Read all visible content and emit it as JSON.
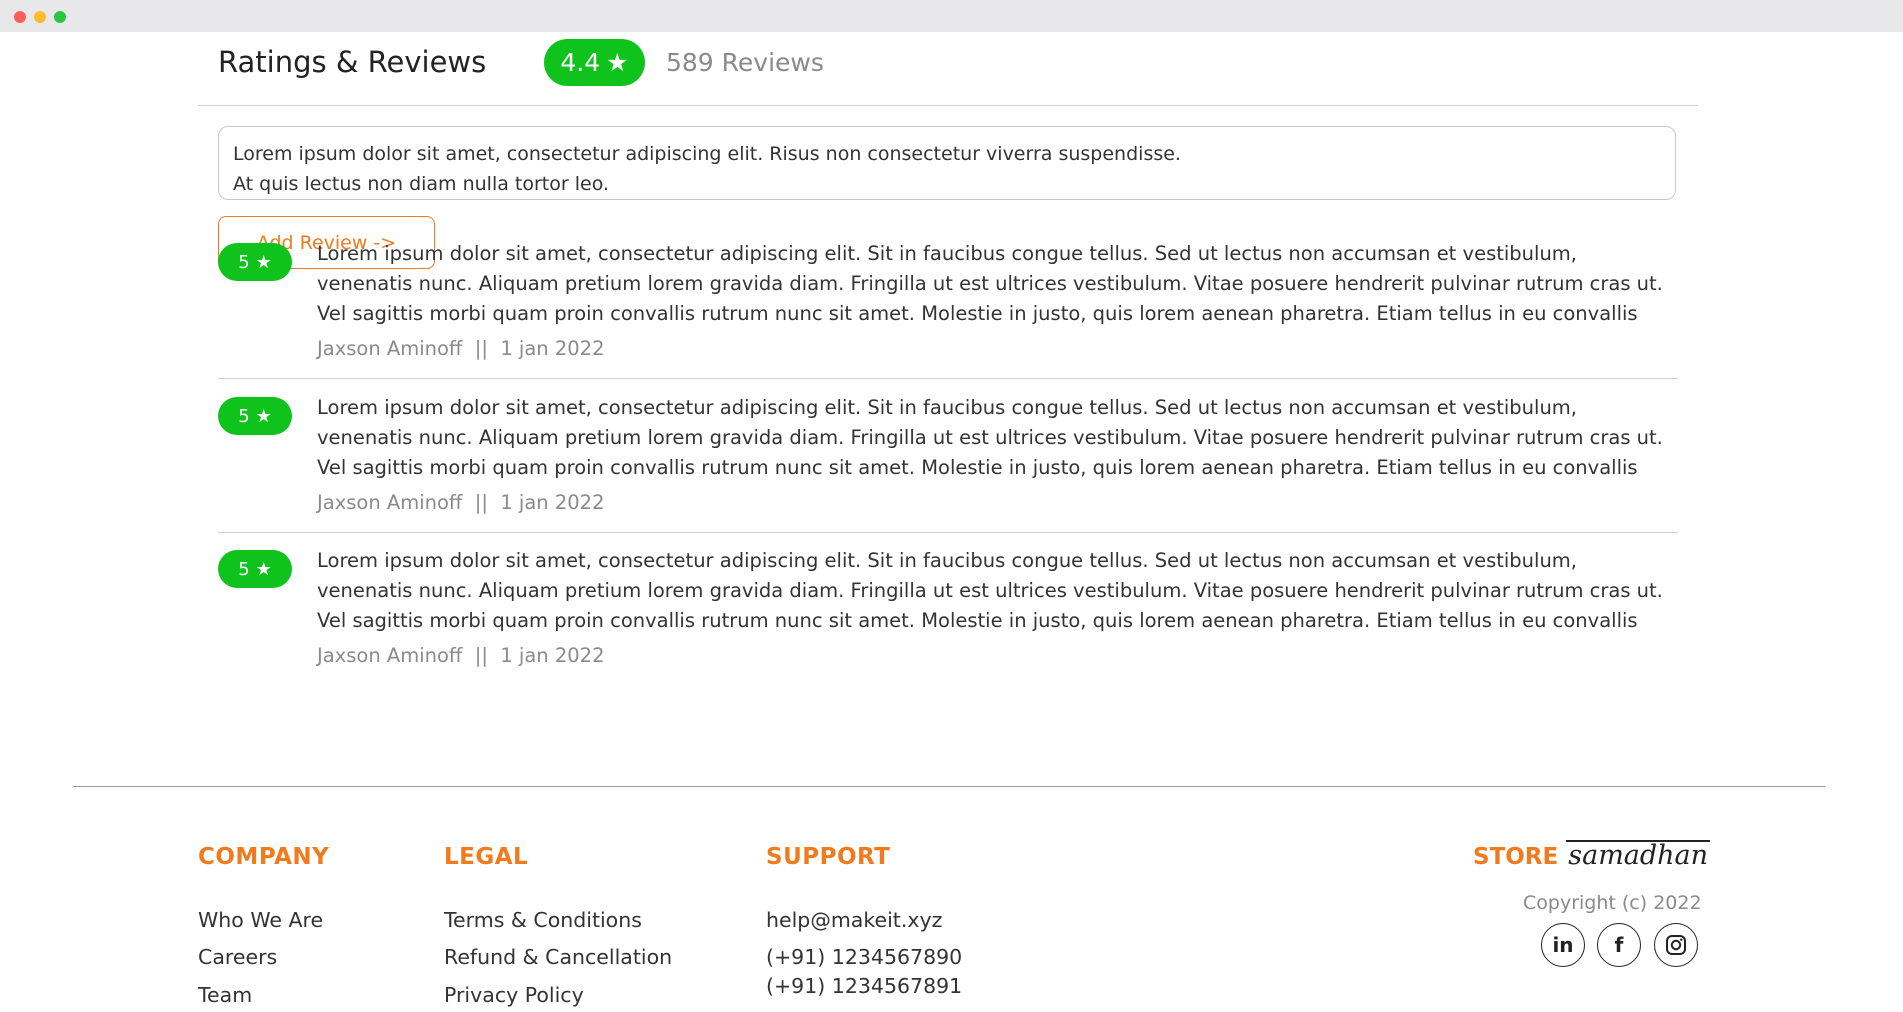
{
  "ratings": {
    "title": "Ratings & Reviews",
    "average": "4.4",
    "count_label": "589 Reviews"
  },
  "review_input": {
    "lines": [
      "Lorem ipsum dolor sit amet, consectetur adipiscing elit. Risus non consectetur viverra suspendisse.",
      "At quis lectus non diam nulla tortor leo."
    ]
  },
  "add_review_label": "Add Review ->",
  "reviews": [
    {
      "rating": "5",
      "lines": [
        "Lorem ipsum dolor sit amet, consectetur adipiscing elit. Sit in faucibus congue tellus. Sed ut lectus non accumsan et vestibulum,",
        "venenatis nunc. Aliquam pretium lorem gravida diam. Fringilla ut est ultrices vestibulum. Vitae posuere hendrerit pulvinar rutrum cras ut.",
        "Vel sagittis morbi quam proin convallis rutrum nunc sit amet. Molestie in justo, quis lorem aenean pharetra. Etiam tellus in eu convallis"
      ],
      "author": "Jaxson Aminoff",
      "separator": "||",
      "date": "1 jan 2022"
    },
    {
      "rating": "5",
      "lines": [
        "Lorem ipsum dolor sit amet, consectetur adipiscing elit. Sit in faucibus congue tellus. Sed ut lectus non accumsan et vestibulum,",
        "venenatis nunc. Aliquam pretium lorem gravida diam. Fringilla ut est ultrices vestibulum. Vitae posuere hendrerit pulvinar rutrum cras ut.",
        "Vel sagittis morbi quam proin convallis rutrum nunc sit amet. Molestie in justo, quis lorem aenean pharetra. Etiam tellus in eu convallis"
      ],
      "author": "Jaxson Aminoff",
      "separator": "||",
      "date": "1 jan 2022"
    },
    {
      "rating": "5",
      "lines": [
        "Lorem ipsum dolor sit amet, consectetur adipiscing elit. Sit in faucibus congue tellus. Sed ut lectus non accumsan et vestibulum,",
        "venenatis nunc. Aliquam pretium lorem gravida diam. Fringilla ut est ultrices vestibulum. Vitae posuere hendrerit pulvinar rutrum cras ut.",
        "Vel sagittis morbi quam proin convallis rutrum nunc sit amet. Molestie in justo, quis lorem aenean pharetra. Etiam tellus in eu convallis"
      ],
      "author": "Jaxson Aminoff",
      "separator": "||",
      "date": "1 jan 2022"
    }
  ],
  "footer": {
    "company": {
      "heading": "COMPANY",
      "links": [
        "Who We Are",
        "Careers",
        "Team"
      ]
    },
    "legal": {
      "heading": "LEGAL",
      "links": [
        "Terms & Conditions",
        "Refund & Cancellation",
        "Privacy Policy"
      ]
    },
    "support": {
      "heading": "SUPPORT",
      "email": "help@makeit.xyz",
      "phones": [
        "(+91) 1234567890",
        "(+91) 1234567891"
      ]
    },
    "logo": {
      "store": "STORE",
      "samadhan": "samadhan"
    },
    "copyright": "Copyright (c) 2022",
    "social_icons": [
      "linkedin-icon",
      "facebook-icon",
      "instagram-icon"
    ]
  },
  "colors": {
    "accent": "#f07b1e",
    "rating_green": "#10c31c"
  }
}
